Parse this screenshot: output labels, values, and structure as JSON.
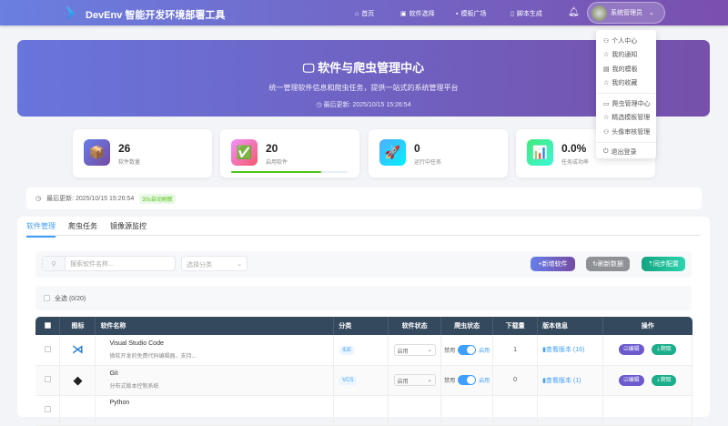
{
  "header": {
    "title": "DevEnv 智能开发环境部署工具",
    "nav": [
      {
        "icon": "home-icon",
        "label": "首页"
      },
      {
        "icon": "package-icon",
        "label": "软件选择"
      },
      {
        "icon": "template-icon",
        "label": "模板广场"
      },
      {
        "icon": "script-icon",
        "label": "脚本生成"
      }
    ],
    "user": "系统管理员"
  },
  "user_menu": [
    {
      "icon": "user-icon",
      "label": "个人中心"
    },
    {
      "icon": "star-icon",
      "label": "我的通知"
    },
    {
      "icon": "document-icon",
      "label": "我的模板"
    },
    {
      "icon": "star-icon",
      "label": "我的收藏"
    },
    {
      "icon": "monitor-icon",
      "label": "爬虫管理中心"
    },
    {
      "icon": "star-icon",
      "label": "精选模板管理"
    },
    {
      "icon": "user-icon",
      "label": "头像审核管理"
    },
    {
      "icon": "power-icon",
      "label": "退出登录"
    }
  ],
  "hero": {
    "title": "软件与爬虫管理中心",
    "subtitle": "统一管理软件信息和爬虫任务，提供一站式的系统管理平台",
    "updated": "最后更新: 2025/10/15 15:26:54"
  },
  "stats": [
    {
      "value": "26",
      "label": "软件数量",
      "icon": "📦",
      "color": "#6b62c8"
    },
    {
      "value": "20",
      "label": "启用软件",
      "icon": "✅",
      "color": "#f05a8a",
      "progress": 0.77
    },
    {
      "value": "0",
      "label": "运行中任务",
      "icon": "🚀",
      "color": "#2ab8f0"
    },
    {
      "value": "0.0%",
      "label": "任务成功率",
      "icon": "📊",
      "color": "#3fe0a0"
    }
  ],
  "update_bar": {
    "text": "最后更新: 2025/10/15 15:26:54",
    "badge": "30s自动刷新"
  },
  "tabs": [
    "软件管理",
    "爬虫任务",
    "镜像源监控"
  ],
  "toolbar": {
    "search_placeholder": "搜索软件名称...",
    "category_placeholder": "选择分类",
    "add": "+新增软件",
    "refresh": "↻刷新数据",
    "sync": "⇡同步配置"
  },
  "select_all": "全选 (0/20)",
  "table": {
    "headers": [
      "",
      "图标",
      "软件名称",
      "分类",
      "软件状态",
      "爬虫状态",
      "下载量",
      "版本信息",
      "操作"
    ],
    "rows": [
      {
        "name": "Visual Studio Code",
        "desc": "微软开发的免费代码编辑器，支持...",
        "category": "IDE",
        "status": "启用",
        "off": "禁用",
        "on": "启用",
        "downloads": "1",
        "versions": "查看版本 (16)",
        "edit": "编辑",
        "crawl": "爬取"
      },
      {
        "name": "Git",
        "desc": "分布式版本控制系统",
        "category": "VCS",
        "status": "启用",
        "off": "禁用",
        "on": "启用",
        "downloads": "0",
        "versions": "查看版本 (1)",
        "edit": "编辑",
        "crawl": "爬取"
      },
      {
        "name": "Python",
        "desc": "",
        "category": "",
        "status": "",
        "off": "",
        "on": "",
        "downloads": "",
        "versions": "",
        "edit": "",
        "crawl": ""
      }
    ]
  }
}
